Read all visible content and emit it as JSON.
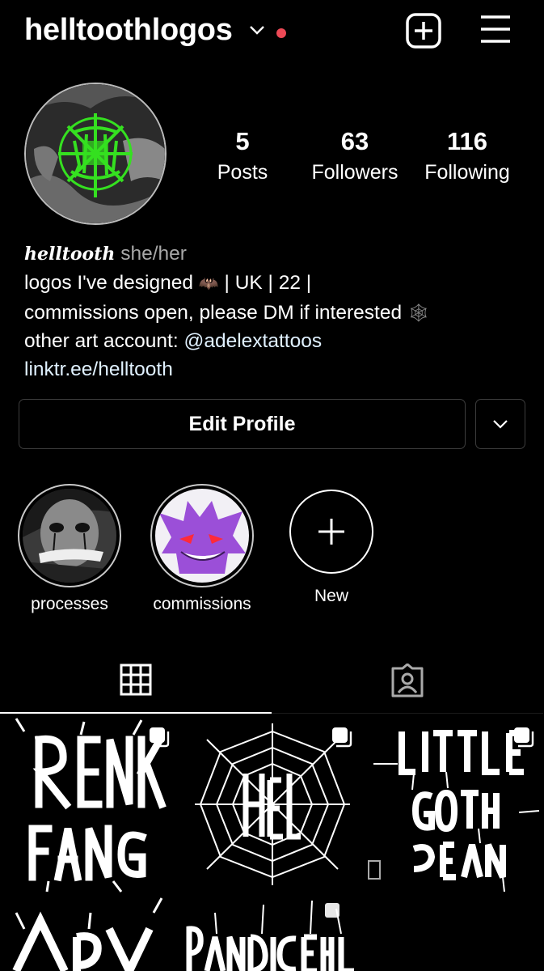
{
  "header": {
    "username": "helltoothlogos",
    "notification_color": "#ed4956"
  },
  "stats": {
    "posts_count": "5",
    "posts_label": "Posts",
    "followers_count": "63",
    "followers_label": "Followers",
    "following_count": "116",
    "following_label": "Following"
  },
  "bio": {
    "name": "helltooth",
    "pronouns": "she/her",
    "line1_text": "logos I've designed",
    "line1_emoji": "bat-emoji",
    "line1_suffix": "| UK | 22 |",
    "line2_text": "commissions open, please DM if interested",
    "line2_emoji": "spiderweb-emoji",
    "line3_prefix": "other art account: ",
    "line3_handle": "@adelextattoos",
    "website": "linktr.ee/helltooth"
  },
  "buttons": {
    "edit_profile": "Edit Profile"
  },
  "highlights": [
    {
      "label": "processes"
    },
    {
      "label": "commissions"
    },
    {
      "label": "New"
    }
  ],
  "tabs": [
    {
      "icon": "grid-icon",
      "active": true
    },
    {
      "icon": "tagged-icon",
      "active": false
    }
  ],
  "posts": [
    {
      "icon": "multiple-posts-icon"
    },
    {
      "icon": "multiple-posts-icon"
    },
    {
      "icon": "multiple-posts-icon"
    },
    {
      "icon": ""
    },
    {
      "icon": ""
    }
  ],
  "colors": {
    "background": "#000000",
    "text": "#ffffff",
    "muted": "#a8a8a8",
    "link": "#e0f1ff",
    "logo_green": "#35e020",
    "gengar_purple": "#9b4fd8"
  }
}
